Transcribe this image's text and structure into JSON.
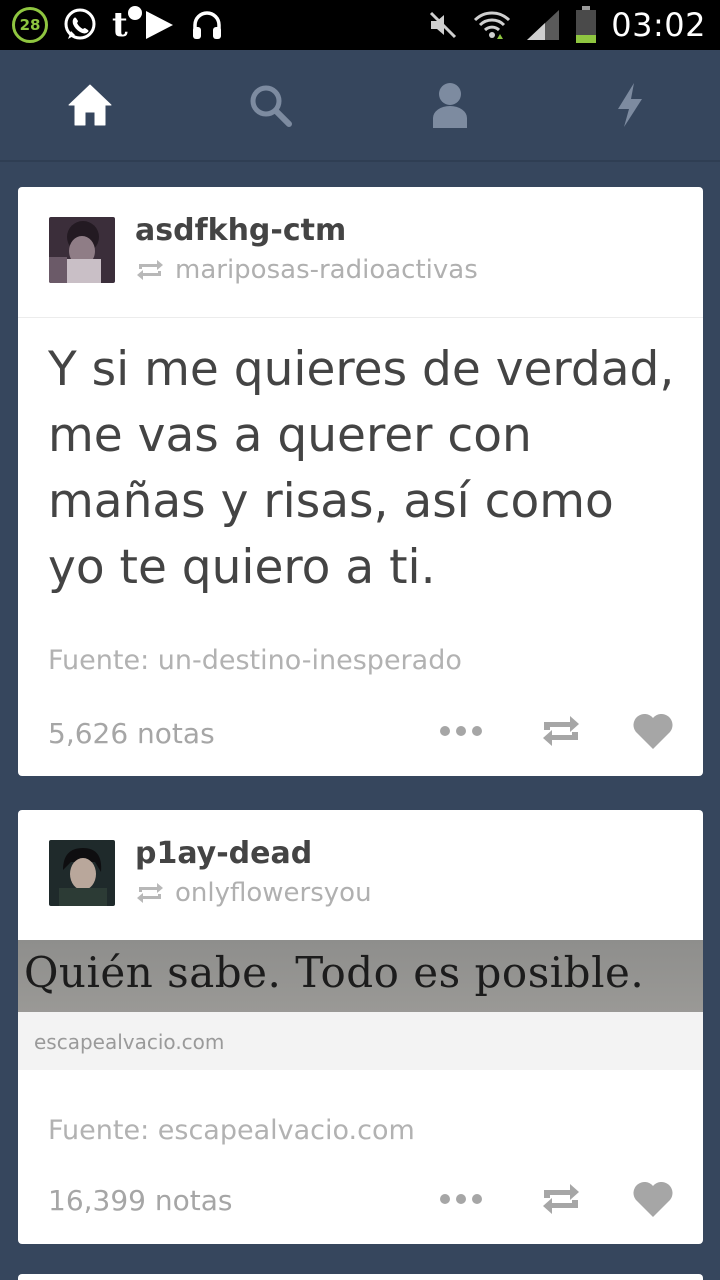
{
  "status_bar": {
    "notification_count": "28",
    "time": "03:02",
    "battery_level": 0.25
  },
  "nav": {
    "items": [
      "home",
      "search",
      "account",
      "activity"
    ],
    "active": "home"
  },
  "posts": [
    {
      "username": "asdfkhg-ctm",
      "reblogged_from": "mariposas-radioactivas",
      "quote": "Y si me quieres de verdad, me vas a querer con mañas y risas, así como yo te quiero a ti.",
      "source": "Fuente: un-destino-inesperado",
      "notes": "5,626 notas"
    },
    {
      "username": "p1ay-dead",
      "reblogged_from": "onlyflowersyou",
      "image_text": "Quién sabe. Todo es posible.",
      "link_domain": "escapealvacio.com",
      "source": "Fuente: escapealvacio.com",
      "notes": "16,399 notas"
    }
  ],
  "colors": {
    "dashboard_bg": "#36465d",
    "card_bg": "#ffffff",
    "text_dark": "#444444",
    "text_muted": "#b0b0b0",
    "battery_green": "#8fc640"
  }
}
